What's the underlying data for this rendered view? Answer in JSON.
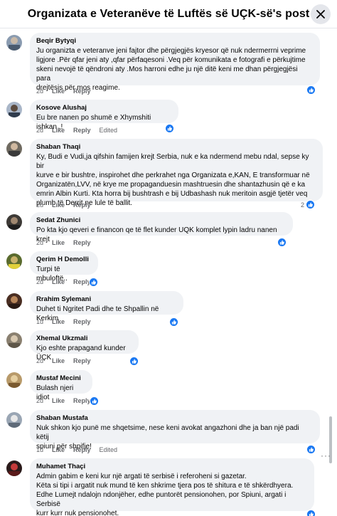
{
  "header": {
    "title": "Organizata e Veteranëve të Luftës së UÇK-së's post"
  },
  "labels": {
    "like": "Like",
    "reply": "Reply",
    "edited": "Edited"
  },
  "comments": [
    {
      "author": "Beqir Bytyqi",
      "lines": [
        "Ju organizta e veteranve jeni fajtor dhe përgjegjës kryesor që nuk ndermerrni veprime",
        "ligjore .Për qfar jeni aty ,qfar përfaqesoni .Veq për komunikata e fotografi e përkujtime",
        "skeni nevojë të qëndroni aty .Mos harroni edhe ju një ditë keni me dhan përgjegjësi para",
        "drejtësis për mos reagime."
      ],
      "time": "2d",
      "edited": false,
      "reactions": ""
    },
    {
      "author": "Kosove Alushaj",
      "lines": [
        "Eu bre nanen po shumë e Xhymshiti ishkan ,!"
      ],
      "time": "2d",
      "edited": true,
      "reactions": ""
    },
    {
      "author": "Shaban Thaqi",
      "lines": [
        "Ky, Budi e Vudi,ja qifshin famijen krejt Serbia, nuk e ka ndermend mebu ndal, sepse ky bir",
        "kurve e bir bushtre, inspirohet dhe perkrahet nga Organizata e,KAN, E transformuar në",
        "Organizatën,LVV, në krye me propaganduesin mashtruesin dhe shantazhusin që e ka",
        "emrin Albin Kurti. Kta horra bij bushtrash e bij Udbashash nuk meritoin asgjë tjetër veq",
        "plumb të Derrit ne lule të ballit."
      ],
      "time": "2d",
      "edited": false,
      "reactions": "2"
    },
    {
      "author": "Sedat Zhunici",
      "lines": [
        "Po kta kjo qeveri e financon qe të flet kunder UQK komplet lypin ladru nanen krejt"
      ],
      "time": "2d",
      "edited": false,
      "reactions": ""
    },
    {
      "author": "Qerim H Demolli",
      "lines": [
        "Turpi të mbuloftë.."
      ],
      "time": "2d",
      "edited": false,
      "reactions": ""
    },
    {
      "author": "Rrahim Sylemani",
      "lines": [
        "Duhet ti Ngritet Padi dhe te Shpallin në Kerkim"
      ],
      "time": "1d",
      "edited": false,
      "reactions": ""
    },
    {
      "author": "Xhemal Ukzmali",
      "lines": [
        "Kjo eshte prapagand kunder ÜÇK"
      ],
      "time": "2d",
      "edited": false,
      "reactions": ""
    },
    {
      "author": "Mustaf Mecini",
      "lines": [
        "Bulash njeri idiot"
      ],
      "time": "2d",
      "edited": false,
      "reactions": ""
    },
    {
      "author": "Shaban Mustafa",
      "lines": [
        "Nuk shkon kjo punë me shqetsime, nese keni avokat angazhoni dhe ja ban një padi këtij",
        "spiuni për shpifje!"
      ],
      "time": "1d",
      "edited": true,
      "reactions": ""
    },
    {
      "author": "Muhamet Thaçi",
      "lines": [
        "Admin gabim e keni kur një argati të serbisë i referoheni si gazetar.",
        "Këta si tipi i argatit nuk mund të ken shkrime tjera pos të shitura e të shkërdhyera.",
        "Edhe Lumejt ndalojn ndonjëher, edhe puntorët pensionohen, por Spiuni, argati i Serbisë",
        "kurr kurr nuk pensionohet."
      ],
      "time": "",
      "edited": false,
      "reactions": ""
    }
  ],
  "icons": {
    "close": "close-icon",
    "like_reaction": "like-reaction-icon",
    "more": "more-options-icon"
  },
  "colors": {
    "accent": "#1877f2",
    "bubble": "#f0f2f5",
    "muted": "#65676b"
  }
}
